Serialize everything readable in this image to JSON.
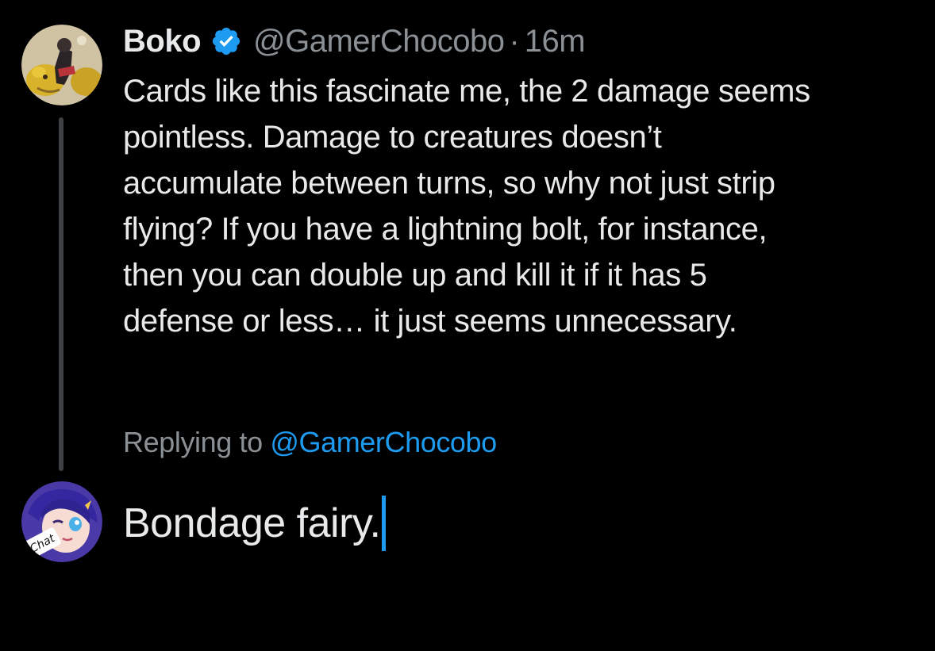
{
  "original_tweet": {
    "display_name": "Boko",
    "handle": "@GamerChocobo",
    "separator": "·",
    "time": "16m",
    "verified": true,
    "avatar_icon": "chocobo-artwork-avatar",
    "text_lines": [
      "Cards like this fascinate me, the 2 damage seems",
      "pointless. Damage to creatures doesn’t",
      "accumulate between turns, so why not just strip",
      "flying? If you have a lightning bolt, for instance,",
      "then you can double up and kill it if it has 5",
      "defense or less… it just seems unnecessary."
    ]
  },
  "reply": {
    "replying_prefix": "Replying to",
    "replying_handle": "@GamerChocobo",
    "avatar_icon": "anime-character-avatar",
    "avatar_badge_text": "Chat",
    "draft_text": "Bondage fairy."
  },
  "colors": {
    "background": "#000000",
    "text_primary": "#e7e9ea",
    "text_secondary": "#8b9095",
    "accent": "#1d9bf0",
    "thread_line": "#3e4144"
  }
}
